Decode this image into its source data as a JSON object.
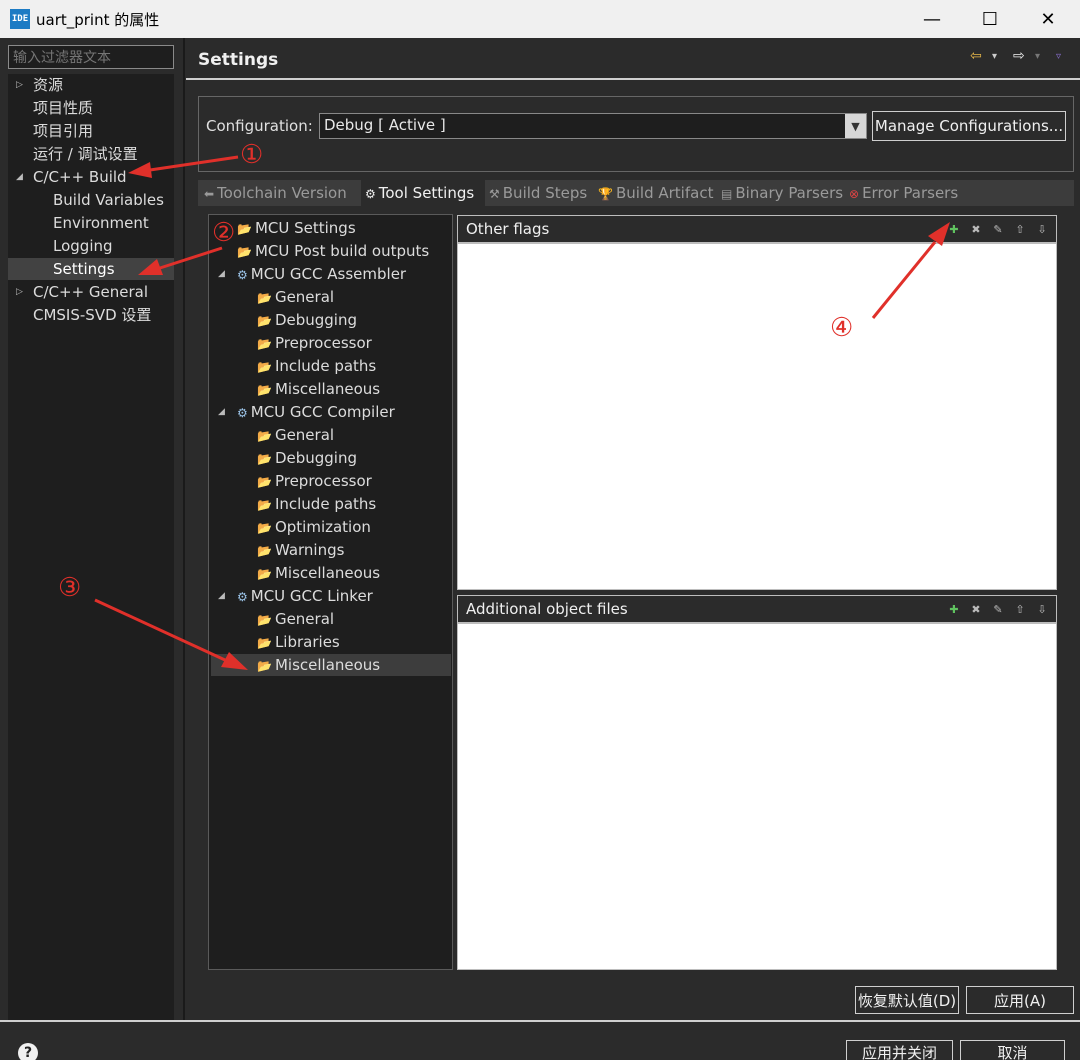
{
  "window": {
    "app_icon": "IDE",
    "title": "uart_print 的属性",
    "min_label": "—",
    "max_label": "☐",
    "close_label": "✕"
  },
  "left": {
    "filter_placeholder": "输入过滤器文本",
    "items": [
      {
        "label": "资源"
      },
      {
        "label": "项目性质"
      },
      {
        "label": "项目引用"
      },
      {
        "label": "运行 / 调试设置"
      },
      {
        "label": "C/C++ Build"
      },
      {
        "label": "Build Variables"
      },
      {
        "label": "Environment"
      },
      {
        "label": "Logging"
      },
      {
        "label": "Settings"
      },
      {
        "label": "C/C++ General"
      },
      {
        "label": "CMSIS-SVD 设置"
      }
    ]
  },
  "right": {
    "title": "Settings",
    "configuration_label": "Configuration:",
    "configuration_value": "Debug  [ Active ]",
    "manage_button": "Manage Configurations...",
    "tabs": [
      {
        "label": "Toolchain  Version"
      },
      {
        "label": "Tool Settings"
      },
      {
        "label": "Build Steps"
      },
      {
        "label": "Build Artifact"
      },
      {
        "label": "Binary Parsers"
      },
      {
        "label": "Error Parsers"
      }
    ],
    "tool_tree": [
      {
        "label": "MCU Settings"
      },
      {
        "label": "MCU Post build outputs"
      },
      {
        "label": "MCU GCC Assembler"
      },
      {
        "label": "General"
      },
      {
        "label": "Debugging"
      },
      {
        "label": "Preprocessor"
      },
      {
        "label": "Include paths"
      },
      {
        "label": "Miscellaneous"
      },
      {
        "label": "MCU GCC Compiler"
      },
      {
        "label": "General"
      },
      {
        "label": "Debugging"
      },
      {
        "label": "Preprocessor"
      },
      {
        "label": "Include paths"
      },
      {
        "label": "Optimization"
      },
      {
        "label": "Warnings"
      },
      {
        "label": "Miscellaneous"
      },
      {
        "label": "MCU GCC Linker"
      },
      {
        "label": "General"
      },
      {
        "label": "Libraries"
      },
      {
        "label": "Miscellaneous"
      }
    ],
    "panel1_title": "Other flags",
    "panel2_title": "Additional object files",
    "restore_button": "恢复默认值(D)",
    "apply_button": "应用(A)"
  },
  "footer": {
    "help": "?",
    "apply_close_button": "应用并关闭",
    "cancel_button": "取消"
  },
  "annotations": {
    "n1": "①",
    "n2": "②",
    "n3": "③",
    "n4": "④",
    "color": "#e0302a"
  }
}
